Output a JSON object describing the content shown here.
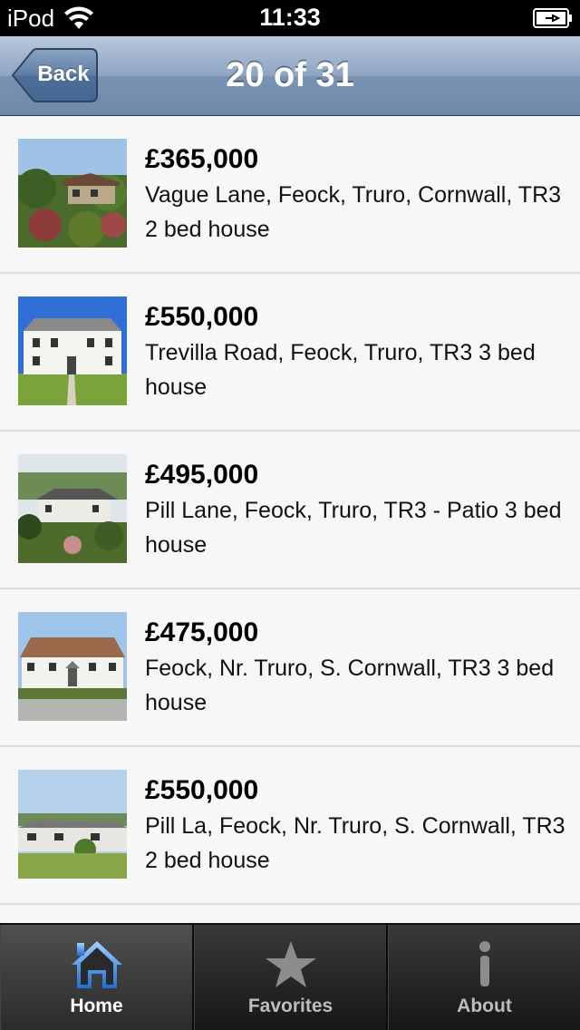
{
  "status_bar": {
    "carrier": "iPod",
    "time": "11:33"
  },
  "nav": {
    "back_label": "Back",
    "title": "20 of 31"
  },
  "listings": [
    {
      "price": "£365,000",
      "address": "Vague Lane, Feock, Truro, Cornwall, TR3 2 bed house"
    },
    {
      "price": "£550,000",
      "address": "Trevilla Road, Feock, Truro, TR3 3 bed house"
    },
    {
      "price": "£495,000",
      "address": "Pill Lane, Feock, Truro, TR3 - Patio 3 bed house"
    },
    {
      "price": "£475,000",
      "address": "Feock, Nr. Truro, S. Cornwall, TR3 3 bed house"
    },
    {
      "price": "£550,000",
      "address": "Pill La, Feock, Nr. Truro, S. Cornwall, TR3 2 bed house"
    }
  ],
  "tabs": [
    {
      "label": "Home",
      "icon": "home-icon",
      "active": true
    },
    {
      "label": "Favorites",
      "icon": "star-icon",
      "active": false
    },
    {
      "label": "About",
      "icon": "info-icon",
      "active": false
    }
  ],
  "colors": {
    "nav_bar": "#7a93b3",
    "tab_bar": "#222222",
    "home_icon_active": "#3a8ee6"
  }
}
